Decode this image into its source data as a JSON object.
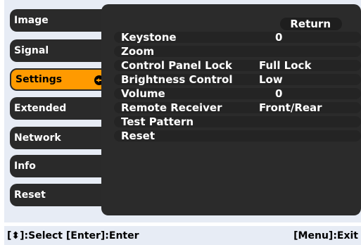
{
  "menu": {
    "items": [
      {
        "label": "Image"
      },
      {
        "label": "Signal"
      },
      {
        "label": "Settings"
      },
      {
        "label": "Extended"
      },
      {
        "label": "Network"
      },
      {
        "label": "Info"
      },
      {
        "label": "Reset"
      }
    ],
    "active_index": 2
  },
  "panel": {
    "return_label": "Return",
    "rows": [
      {
        "label": "Keystone",
        "value": "0"
      },
      {
        "label": "Zoom",
        "value": ""
      },
      {
        "label": "Control Panel Lock",
        "value": "Full Lock"
      },
      {
        "label": "Brightness Control",
        "value": "Low"
      },
      {
        "label": "Volume",
        "value": "0"
      },
      {
        "label": "Remote Receiver",
        "value": "Front/Rear"
      },
      {
        "label": "Test Pattern",
        "value": ""
      },
      {
        "label": "Reset",
        "value": ""
      }
    ]
  },
  "statusbar": {
    "left": "[⬍]:Select  [Enter]:Enter",
    "right": "[Menu]:Exit"
  },
  "colors": {
    "accent": "#ff9a00",
    "panel": "#2b2b2b",
    "frame": "#e7ecf5"
  },
  "icons": {
    "enter": "enter-icon"
  }
}
